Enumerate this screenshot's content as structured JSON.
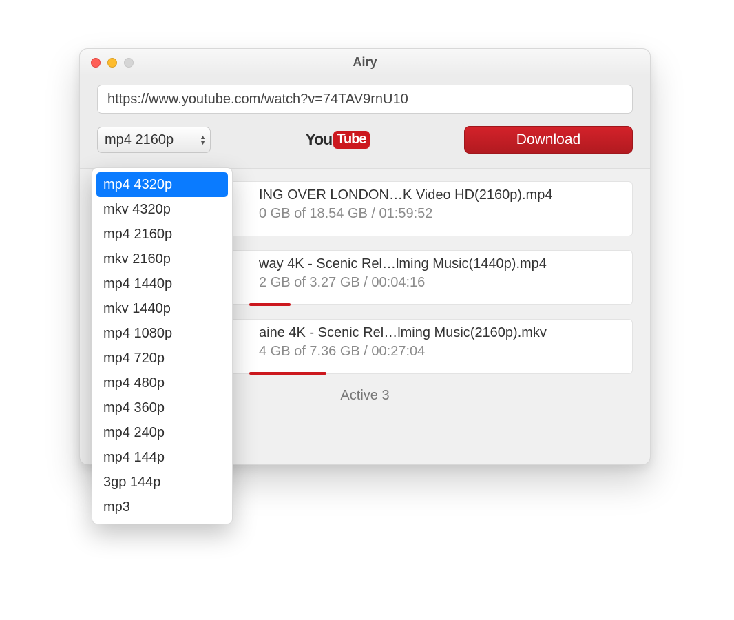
{
  "window": {
    "title": "Airy"
  },
  "toolbar": {
    "url_value": "https://www.youtube.com/watch?v=74TAV9rnU10",
    "format_selected": "mp4 2160p",
    "download_label": "Download",
    "youtube_you": "You",
    "youtube_tube": "Tube"
  },
  "format_dropdown": {
    "highlighted_index": 0,
    "items": [
      "mp4 4320p",
      "mkv 4320p",
      "mp4 2160p",
      "mkv 2160p",
      "mp4 1440p",
      "mkv 1440p",
      "mp4 1080p",
      "mp4 720p",
      "mp4 480p",
      "mp4 360p",
      "mp4 240p",
      "mp4 144p",
      "3gp 144p",
      "mp3"
    ]
  },
  "downloads": [
    {
      "title": "ING OVER LONDON…K Video HD(2160p).mp4",
      "status": "0 GB of 18.54 GB / 01:59:52",
      "progress_pct": 0
    },
    {
      "title": "way 4K - Scenic Rel…lming Music(1440p).mp4",
      "status": "2 GB of 3.27 GB / 00:04:16",
      "progress_pct": 12
    },
    {
      "title": "aine 4K - Scenic Rel…lming Music(2160p).mkv",
      "status": "4 GB of 7.36 GB / 00:27:04",
      "progress_pct": 22
    }
  ],
  "footer": {
    "active_label": "Active 3"
  }
}
